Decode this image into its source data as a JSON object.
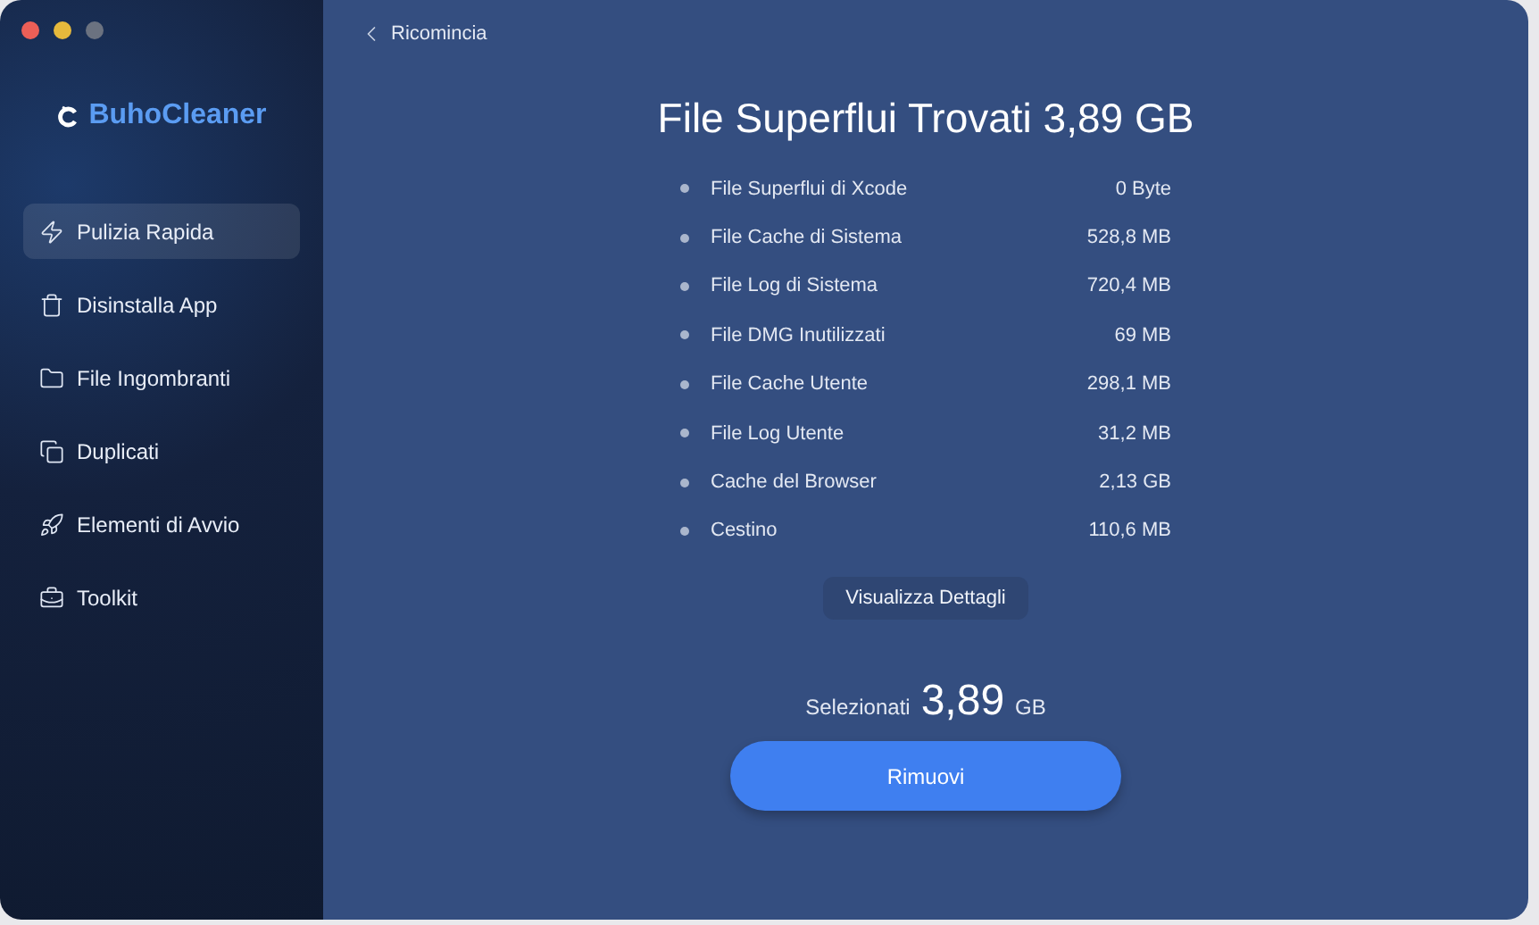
{
  "app": {
    "name": "BuhoCleaner"
  },
  "sidebar": {
    "items": [
      {
        "label": "Pulizia Rapida",
        "selected": true
      },
      {
        "label": "Disinstalla App",
        "selected": false
      },
      {
        "label": "File Ingombranti",
        "selected": false
      },
      {
        "label": "Duplicati",
        "selected": false
      },
      {
        "label": "Elementi di Avvio",
        "selected": false
      },
      {
        "label": "Toolkit",
        "selected": false
      }
    ]
  },
  "back_link": "Ricomincia",
  "title": "File Superflui Trovati 3,89 GB",
  "items": [
    {
      "name": "File Superflui di Xcode",
      "size": "0 Byte"
    },
    {
      "name": "File Cache di Sistema",
      "size": "528,8 MB"
    },
    {
      "name": "File Log di Sistema",
      "size": "720,4 MB"
    },
    {
      "name": "File DMG Inutilizzati",
      "size": "69 MB"
    },
    {
      "name": "File Cache Utente",
      "size": "298,1 MB"
    },
    {
      "name": "File Log Utente",
      "size": "31,2 MB"
    },
    {
      "name": "Cache del Browser",
      "size": "2,13 GB"
    },
    {
      "name": "Cestino",
      "size": "110,6 MB"
    }
  ],
  "details_button": "Visualizza Dettagli",
  "selected_summary": {
    "label": "Selezionati",
    "value": "3,89",
    "unit": "GB"
  },
  "remove_button": "Rimuovi"
}
